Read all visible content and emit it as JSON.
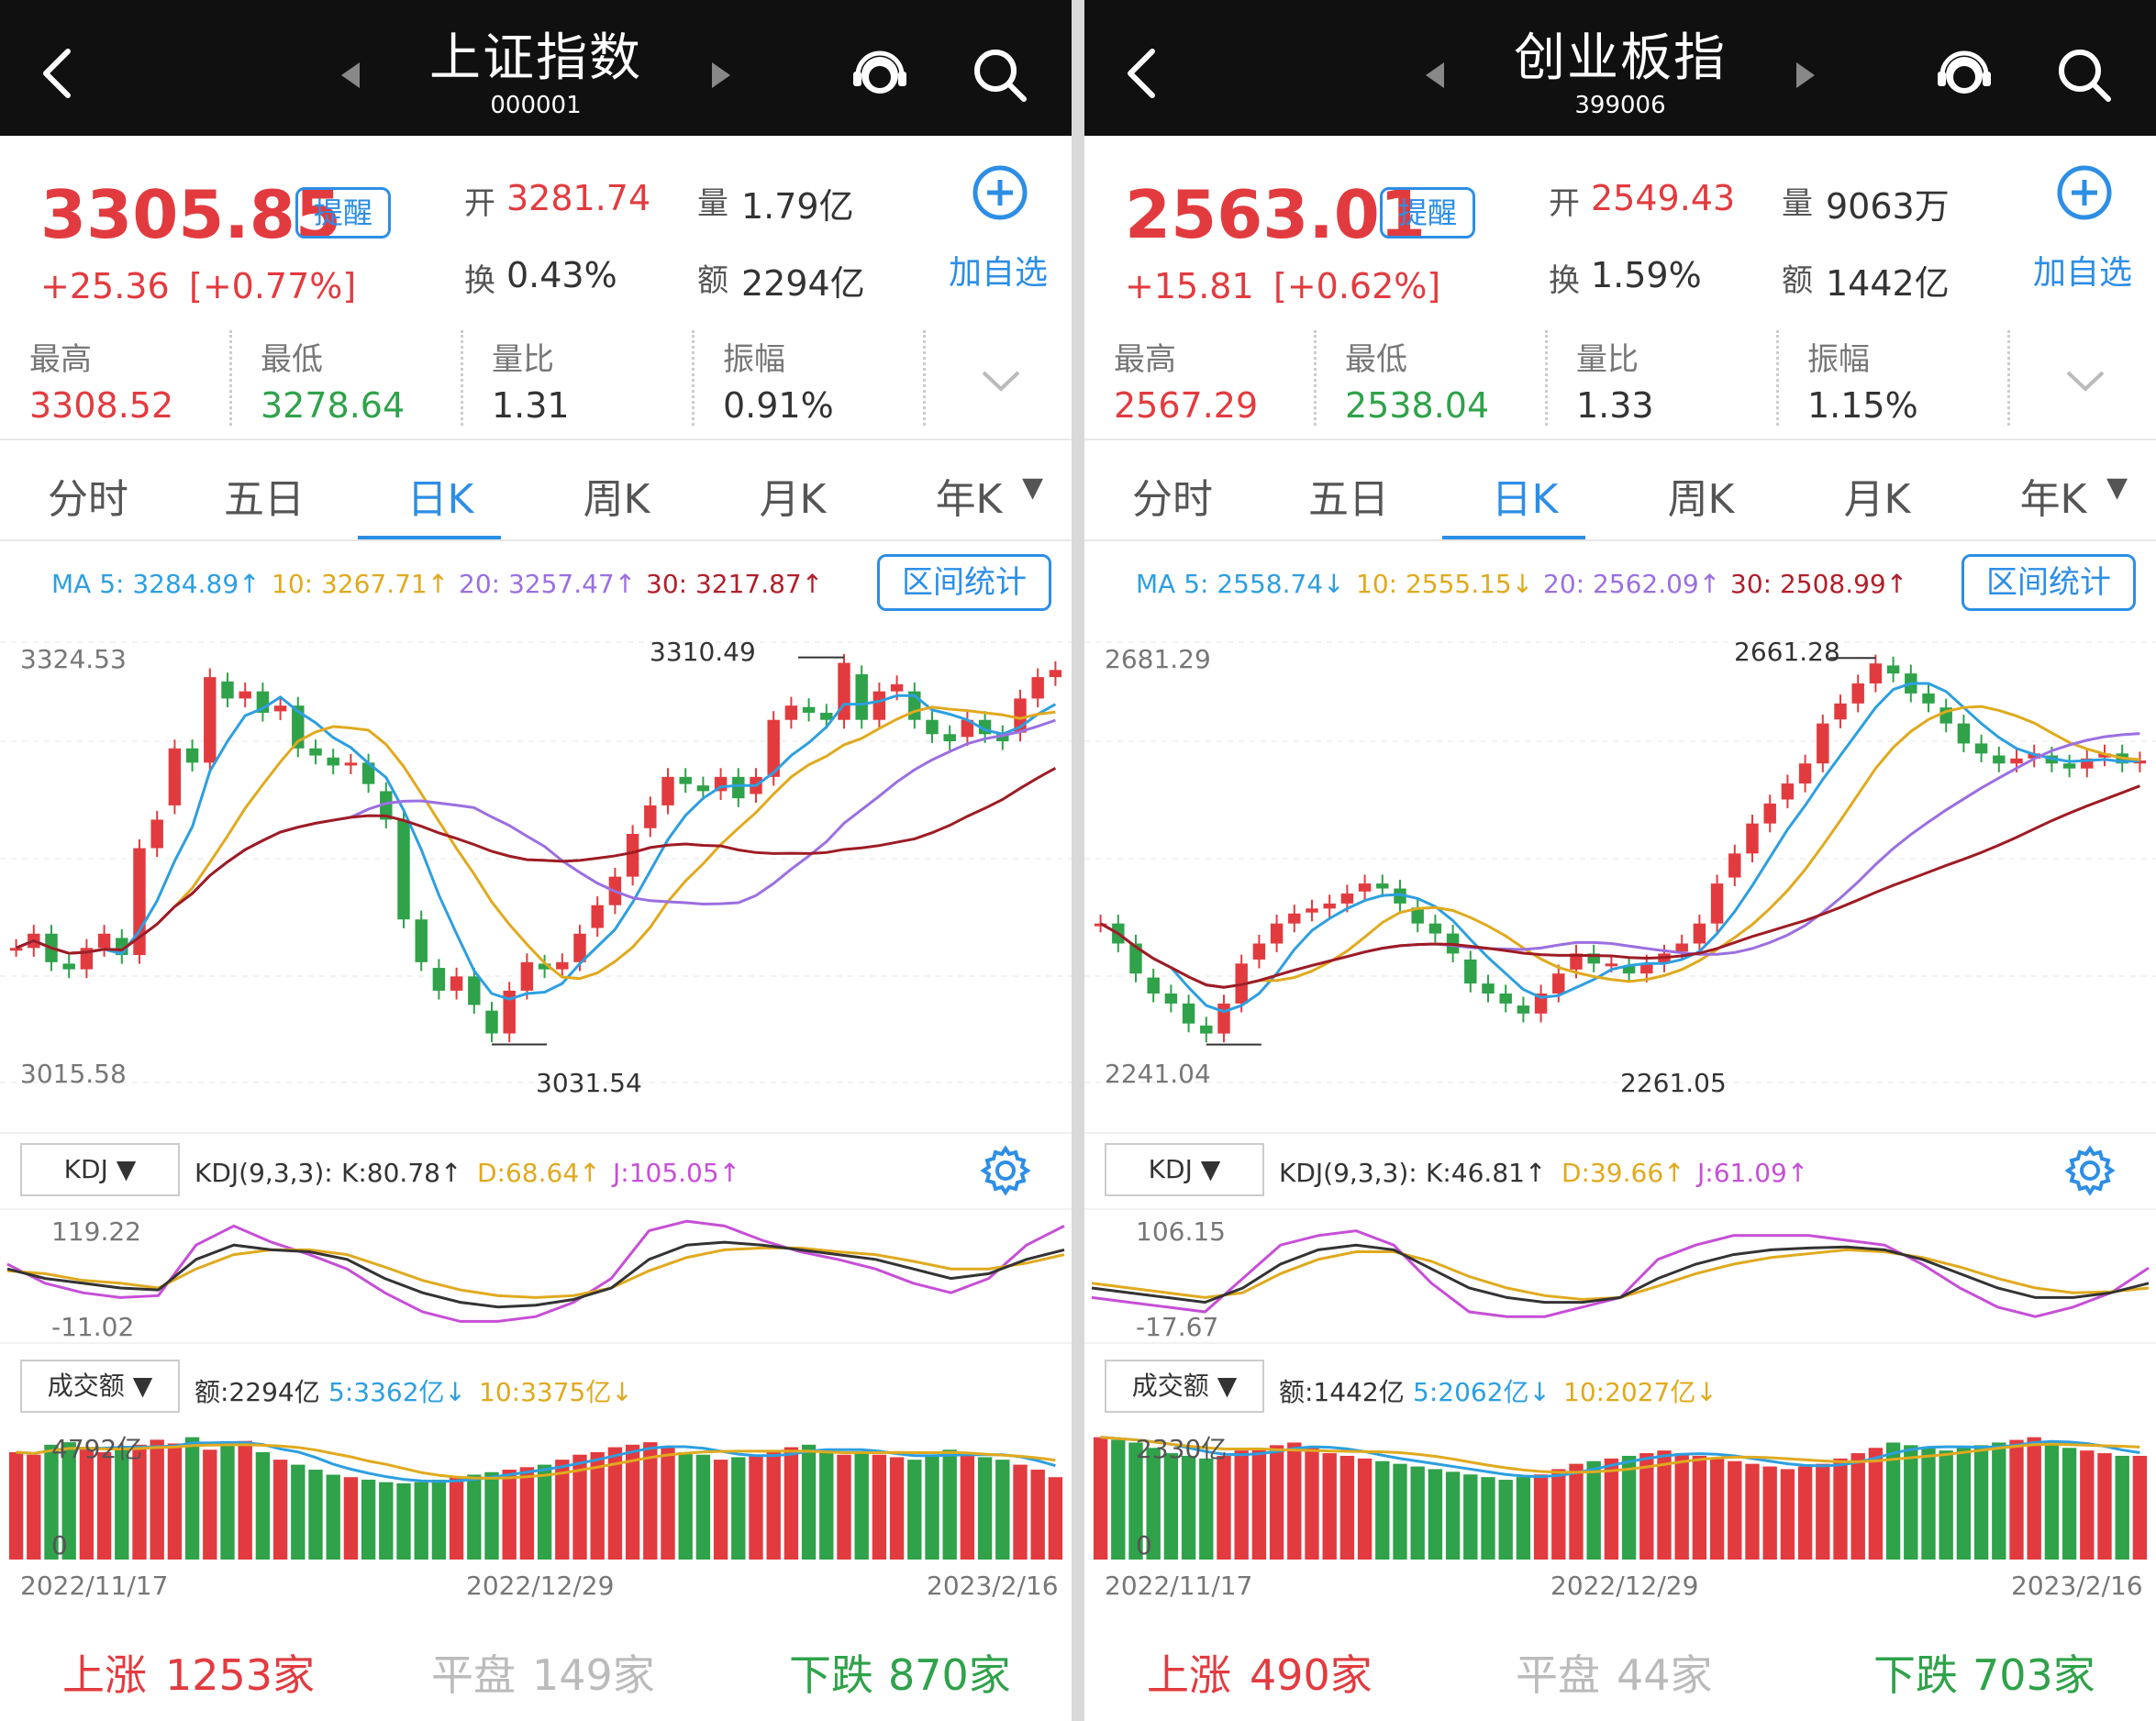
{
  "colors": {
    "rise": "#e23b3f",
    "fall": "#2fa24a",
    "accent": "#2d8ee5",
    "ma5": "#2d9fe0",
    "ma10": "#e0aa1e",
    "ma20": "#9b6fe0",
    "ma30": "#9e1c24"
  },
  "icons": {
    "back": "chevron-left-icon",
    "prev": "triangle-left-icon",
    "next": "triangle-right-icon",
    "service": "customer-service-icon",
    "search": "search-icon",
    "add": "plus-circle-icon",
    "expand": "chevron-down-icon",
    "settings": "gear-icon",
    "dropdown": "caret-down-icon"
  },
  "panels": [
    {
      "title": "上证指数",
      "code": "000001",
      "price": "3305.85",
      "alert": "提醒",
      "change": "+25.36",
      "change_pct": "[+0.77%]",
      "open_label": "开",
      "open": "3281.74",
      "vol_label": "量",
      "vol": "1.79亿",
      "turnover_label": "换",
      "turnover": "0.43%",
      "amount_label": "额",
      "amount": "2294亿",
      "add_label": "加自选",
      "stats": [
        {
          "label": "最高",
          "value": "3308.52"
        },
        {
          "label": "最低",
          "value": "3278.64"
        },
        {
          "label": "量比",
          "value": "1.31"
        },
        {
          "label": "振幅",
          "value": "0.91%"
        }
      ],
      "tabs": [
        "分时",
        "五日",
        "日K",
        "周K",
        "月K",
        "年K"
      ],
      "active_tab": 2,
      "ma": {
        "ma5": "MA 5: 3284.89↑",
        "ma10": "10: 3267.71↑",
        "ma20": "20: 3257.47↑",
        "ma30": "30: 3217.87↑"
      },
      "range_btn": "区间统计",
      "chart_top": "3324.53",
      "chart_bottom": "3015.58",
      "max_label": "3310.49",
      "min_label": "3031.54",
      "kdj_btn": "KDJ",
      "kdj_head": "KDJ(9,3,3):",
      "kdj_k": "K:80.78↑",
      "kdj_d": "D:68.64↑",
      "kdj_j": "J:105.05↑",
      "kdj_top": "119.22",
      "kdj_bottom": "-11.02",
      "vol_btn": "成交额",
      "vol_head": "额:2294亿",
      "vol_5": "5:3362亿↓",
      "vol_10": "10:3375亿↓",
      "vol_top": "4792亿",
      "vol_zero": "0",
      "dates": [
        "2022/11/17",
        "2022/12/29",
        "2023/2/16"
      ],
      "foot": {
        "up_label": "上涨",
        "up": "1253家",
        "flat_label": "平盘",
        "flat": "149家",
        "down_label": "下跌",
        "down": "870家"
      },
      "chart_data": {
        "type": "candlestick",
        "ylim": [
          3015.58,
          3324.53
        ],
        "max_close": 3310.49,
        "min_low": 3031.54,
        "close": [
          3110,
          3120,
          3100,
          3095,
          3110,
          3120,
          3105,
          3180,
          3200,
          3250,
          3240,
          3300,
          3285,
          3290,
          3275,
          3280,
          3250,
          3245,
          3238,
          3240,
          3225,
          3200,
          3130,
          3100,
          3080,
          3090,
          3070,
          3050,
          3080,
          3100,
          3095,
          3100,
          3120,
          3140,
          3160,
          3190,
          3210,
          3230,
          3225,
          3220,
          3230,
          3215,
          3230,
          3270,
          3280,
          3275,
          3270,
          3310,
          3270,
          3290,
          3295,
          3270,
          3260,
          3255,
          3270,
          3260,
          3255,
          3285,
          3300,
          3305
        ],
        "kdj_k": [
          60,
          50,
          45,
          40,
          38,
          70,
          85,
          80,
          78,
          70,
          50,
          35,
          25,
          20,
          22,
          28,
          40,
          70,
          85,
          88,
          85,
          80,
          75,
          70,
          60,
          50,
          55,
          70,
          80
        ],
        "kdj_d": [
          58,
          55,
          48,
          45,
          40,
          60,
          75,
          80,
          80,
          75,
          62,
          48,
          38,
          32,
          30,
          32,
          40,
          58,
          72,
          80,
          82,
          82,
          78,
          75,
          68,
          60,
          60,
          66,
          75
        ],
        "kdj_j": [
          65,
          45,
          35,
          30,
          32,
          85,
          105,
          88,
          75,
          60,
          35,
          15,
          5,
          5,
          10,
          25,
          50,
          100,
          110,
          105,
          90,
          78,
          70,
          60,
          45,
          35,
          50,
          85,
          105
        ],
        "amount": [
          4300,
          4200,
          4600,
          4700,
          4500,
          4300,
          4400,
          4600,
          4800,
          4650,
          4900,
          4400,
          4700,
          4750,
          4300,
          4000,
          3800,
          3600,
          3400,
          3300,
          3200,
          3100,
          3050,
          3100,
          3200,
          3300,
          3400,
          3500,
          3600,
          3700,
          3800,
          4000,
          4200,
          4300,
          4500,
          4600,
          4700,
          4500,
          4300,
          4200,
          4000,
          4100,
          4200,
          4300,
          4500,
          4600,
          4400,
          4200,
          4300,
          4200,
          4100,
          4000,
          4200,
          4400,
          4300,
          4100,
          4000,
          3800,
          3600,
          3300
        ]
      }
    },
    {
      "title": "创业板指",
      "code": "399006",
      "price": "2563.01",
      "alert": "提醒",
      "change": "+15.81",
      "change_pct": "[+0.62%]",
      "open_label": "开",
      "open": "2549.43",
      "vol_label": "量",
      "vol": "9063万",
      "turnover_label": "换",
      "turnover": "1.59%",
      "amount_label": "额",
      "amount": "1442亿",
      "add_label": "加自选",
      "stats": [
        {
          "label": "最高",
          "value": "2567.29"
        },
        {
          "label": "最低",
          "value": "2538.04"
        },
        {
          "label": "量比",
          "value": "1.33"
        },
        {
          "label": "振幅",
          "value": "1.15%"
        }
      ],
      "tabs": [
        "分时",
        "五日",
        "日K",
        "周K",
        "月K",
        "年K"
      ],
      "active_tab": 2,
      "ma": {
        "ma5": "MA 5: 2558.74↓",
        "ma10": "10: 2555.15↓",
        "ma20": "20: 2562.09↑",
        "ma30": "30: 2508.99↑"
      },
      "range_btn": "区间统计",
      "chart_top": "2681.29",
      "chart_bottom": "2241.04",
      "max_label": "2661.28",
      "min_label": "2261.05",
      "kdj_btn": "KDJ",
      "kdj_head": "KDJ(9,3,3):",
      "kdj_k": "K:46.81↑",
      "kdj_d": "D:39.66↑",
      "kdj_j": "J:61.09↑",
      "kdj_top": "106.15",
      "kdj_bottom": "-17.67",
      "vol_btn": "成交额",
      "vol_head": "额:1442亿",
      "vol_5": "5:2062亿↓",
      "vol_10": "10:2027亿↓",
      "vol_top": "2330亿",
      "vol_zero": "0",
      "dates": [
        "2022/11/17",
        "2022/12/29",
        "2023/2/16"
      ],
      "foot": {
        "up_label": "上涨",
        "up": "490家",
        "flat_label": "平盘",
        "flat": "44家",
        "down_label": "下跌",
        "down": "703家"
      },
      "chart_data": {
        "type": "candlestick",
        "ylim": [
          2241.04,
          2681.29
        ],
        "max_close": 2661.28,
        "min_low": 2261.05,
        "close": [
          2400,
          2380,
          2350,
          2330,
          2320,
          2300,
          2290,
          2320,
          2360,
          2380,
          2400,
          2410,
          2415,
          2420,
          2430,
          2440,
          2435,
          2420,
          2400,
          2390,
          2370,
          2340,
          2330,
          2320,
          2310,
          2330,
          2350,
          2370,
          2360,
          2360,
          2350,
          2360,
          2370,
          2380,
          2400,
          2440,
          2470,
          2500,
          2520,
          2540,
          2560,
          2600,
          2620,
          2640,
          2660,
          2650,
          2630,
          2620,
          2600,
          2580,
          2570,
          2560,
          2565,
          2570,
          2560,
          2555,
          2565,
          2570,
          2560,
          2563
        ],
        "kdj_k": [
          40,
          35,
          30,
          25,
          40,
          65,
          80,
          85,
          80,
          60,
          40,
          30,
          25,
          25,
          30,
          50,
          65,
          75,
          80,
          82,
          83,
          80,
          70,
          55,
          40,
          30,
          30,
          35,
          45
        ],
        "kdj_d": [
          45,
          40,
          35,
          30,
          35,
          55,
          70,
          78,
          78,
          68,
          52,
          40,
          32,
          28,
          30,
          42,
          55,
          65,
          72,
          76,
          80,
          78,
          72,
          62,
          50,
          40,
          35,
          36,
          40
        ],
        "kdj_j": [
          30,
          25,
          20,
          15,
          50,
          85,
          95,
          100,
          85,
          45,
          15,
          10,
          10,
          20,
          30,
          70,
          85,
          95,
          95,
          95,
          90,
          85,
          65,
          40,
          20,
          10,
          20,
          35,
          61
        ],
        "amount": [
          2300,
          2250,
          2200,
          2100,
          2000,
          1950,
          1900,
          1950,
          2050,
          2100,
          2150,
          2200,
          2100,
          2000,
          1950,
          1900,
          1850,
          1800,
          1750,
          1700,
          1650,
          1600,
          1550,
          1500,
          1550,
          1600,
          1700,
          1800,
          1850,
          1900,
          1950,
          2000,
          2050,
          2000,
          1950,
          1900,
          1850,
          1800,
          1750,
          1700,
          1750,
          1800,
          1900,
          2000,
          2100,
          2200,
          2150,
          2100,
          2050,
          2100,
          2150,
          2200,
          2250,
          2300,
          2200,
          2100,
          2050,
          2000,
          1950,
          1950
        ]
      }
    }
  ]
}
